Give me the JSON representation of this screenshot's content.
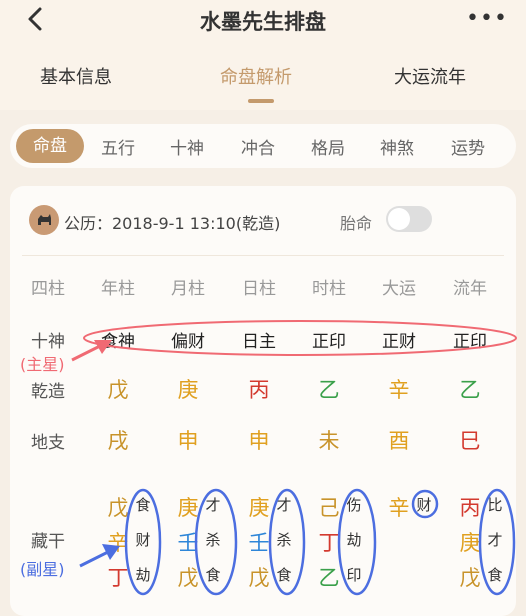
{
  "header": {
    "title": "水墨先生排盘",
    "more": "•••"
  },
  "main_tabs": [
    {
      "label": "基本信息"
    },
    {
      "label": "命盘解析"
    },
    {
      "label": "大运流年"
    }
  ],
  "sub_tabs": [
    "命盘",
    "五行",
    "十神",
    "冲合",
    "格局",
    "神煞",
    "运势"
  ],
  "info": {
    "solar_date": "公历：2018-9-1 13:10(乾造)",
    "taiming_label": "胎命"
  },
  "table": {
    "corner": "四柱",
    "columns": [
      "年柱",
      "月柱",
      "日柱",
      "时柱",
      "大运",
      "流年"
    ],
    "row_labels": {
      "shishen": "十神",
      "qianzao": "乾造",
      "dizhi": "地支",
      "canggan": "藏干"
    },
    "shishen": [
      "食神",
      "偏财",
      "日主",
      "正印",
      "正财",
      "正印"
    ],
    "heavenly_stems": [
      {
        "char": "戊",
        "color": "#c8932a"
      },
      {
        "char": "庚",
        "color": "#e0a020"
      },
      {
        "char": "丙",
        "color": "#d33a2f"
      },
      {
        "char": "乙",
        "color": "#3aa04a"
      },
      {
        "char": "辛",
        "color": "#e0a020"
      },
      {
        "char": "乙",
        "color": "#3aa04a"
      }
    ],
    "earthly_branches": [
      {
        "char": "戌",
        "color": "#c8932a"
      },
      {
        "char": "申",
        "color": "#e0a020"
      },
      {
        "char": "申",
        "color": "#e0a020"
      },
      {
        "char": "未",
        "color": "#c8932a"
      },
      {
        "char": "酉",
        "color": "#e0a020"
      },
      {
        "char": "巳",
        "color": "#d33a2f"
      }
    ],
    "hidden_stems": [
      [
        [
          "戊",
          "食",
          "earth"
        ],
        [
          "辛",
          "财",
          "metal"
        ],
        [
          "丁",
          "劫",
          "fire"
        ]
      ],
      [
        [
          "庚",
          "才",
          "metal"
        ],
        [
          "壬",
          "杀",
          "water"
        ],
        [
          "戊",
          "食",
          "earth"
        ]
      ],
      [
        [
          "庚",
          "才",
          "metal"
        ],
        [
          "壬",
          "杀",
          "water"
        ],
        [
          "戊",
          "食",
          "earth"
        ]
      ],
      [
        [
          "己",
          "伤",
          "earth"
        ],
        [
          "丁",
          "劫",
          "fire"
        ],
        [
          "乙",
          "印",
          "wood"
        ]
      ],
      [
        [
          "辛",
          "财",
          "metal"
        ]
      ],
      [
        [
          "丙",
          "比",
          "fire"
        ],
        [
          "庚",
          "才",
          "metal"
        ],
        [
          "戊",
          "食",
          "earth"
        ]
      ]
    ]
  },
  "annotations": {
    "main_star": "(主星)",
    "sub_star": "(副星)"
  },
  "colors": {
    "accent": "#c49a6c",
    "annotation_red": "#f06a73",
    "annotation_blue": "#4c6ee0"
  }
}
